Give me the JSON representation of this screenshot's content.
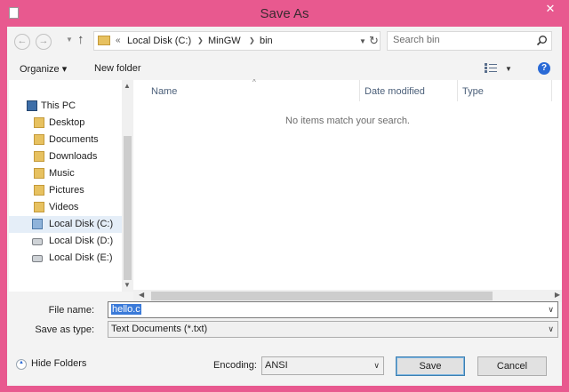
{
  "window": {
    "title": "Save As",
    "close_glyph": "✕"
  },
  "navigation": {
    "back_glyph": "←",
    "forward_glyph": "→",
    "up_glyph": "↑"
  },
  "address": {
    "overflow_glyph": "«",
    "crumbs": [
      "Local Disk (C:)",
      "MinGW",
      "bin"
    ],
    "refresh_glyph": "↻"
  },
  "search": {
    "placeholder": "Search bin"
  },
  "toolbar": {
    "organize_label": "Organize ▾",
    "new_folder_label": "New folder",
    "help_glyph": "?"
  },
  "nav_tree": {
    "root": "This PC",
    "items": [
      {
        "label": "Desktop",
        "icon": "folder-icon"
      },
      {
        "label": "Documents",
        "icon": "folder-icon"
      },
      {
        "label": "Downloads",
        "icon": "folder-icon"
      },
      {
        "label": "Music",
        "icon": "folder-icon"
      },
      {
        "label": "Pictures",
        "icon": "folder-icon"
      },
      {
        "label": "Videos",
        "icon": "folder-icon"
      },
      {
        "label": "Local Disk (C:)",
        "icon": "system-drive-icon",
        "selected": true
      },
      {
        "label": "Local Disk (D:)",
        "icon": "drive-icon"
      },
      {
        "label": "Local Disk (E:)",
        "icon": "drive-icon"
      }
    ]
  },
  "file_list": {
    "columns": [
      "Name",
      "Date modified",
      "Type"
    ],
    "empty_message": "No items match your search."
  },
  "form": {
    "file_name_label": "File name:",
    "file_name_value": "hello.c",
    "save_type_label": "Save as type:",
    "save_type_value": "Text Documents (*.txt)"
  },
  "footer": {
    "hide_folders_label": "Hide Folders",
    "encoding_label": "Encoding:",
    "encoding_value": "ANSI",
    "save_label": "Save",
    "cancel_label": "Cancel"
  },
  "colors": {
    "title_bar": "#e8598f",
    "dialog_bg": "#f3f3f3",
    "selection": "#3a7ad9",
    "header_text": "#4c607a"
  }
}
